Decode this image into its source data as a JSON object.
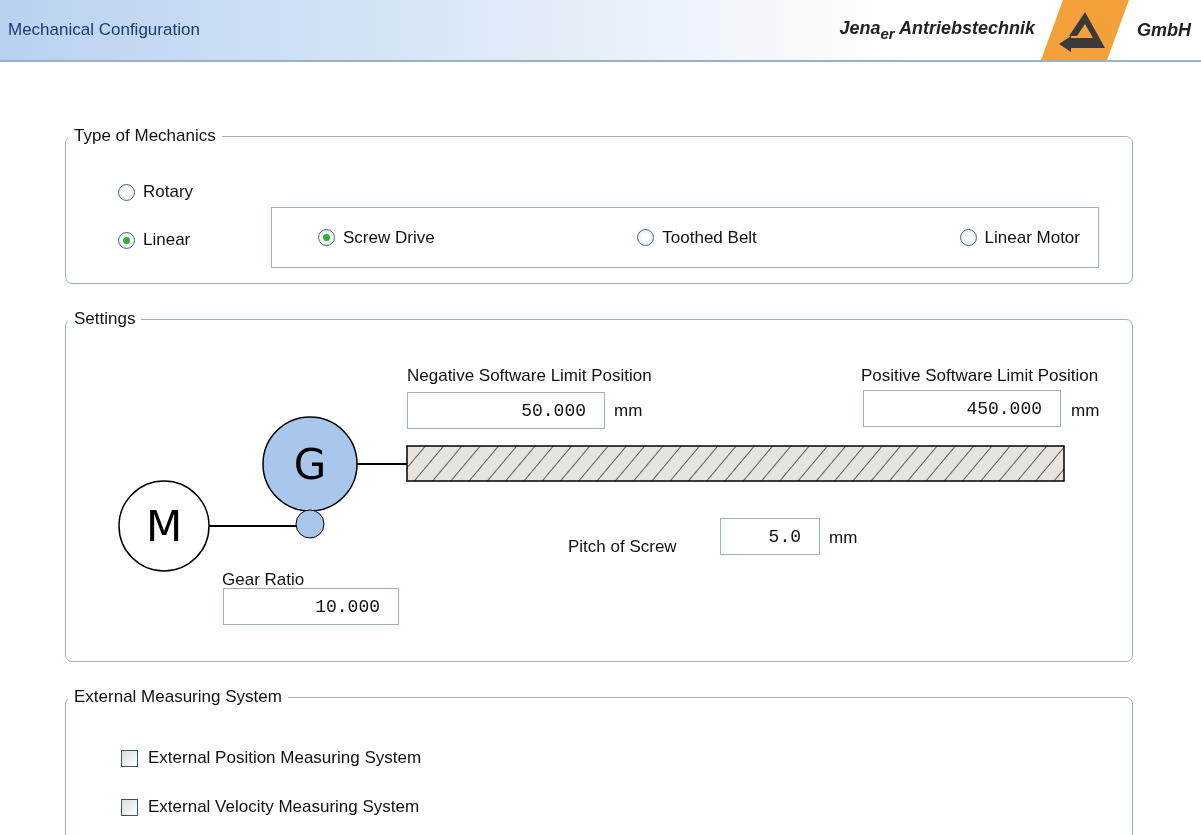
{
  "header": {
    "title": "Mechanical Configuration",
    "logo": {
      "text_left": "Jena$_{er}$ Antriebstechnik",
      "text_right": "GmbH"
    }
  },
  "type_of_mechanics": {
    "legend": "Type of Mechanics",
    "types": [
      {
        "label": "Rotary",
        "selected": false
      },
      {
        "label": "Linear",
        "selected": true
      }
    ],
    "linear_options": [
      {
        "label": "Screw Drive",
        "selected": true
      },
      {
        "label": "Toothed Belt",
        "selected": false
      },
      {
        "label": "Linear Motor",
        "selected": false
      }
    ]
  },
  "settings": {
    "legend": "Settings",
    "motor_label": "M",
    "gear_label": "G",
    "negative_limit": {
      "label": "Negative Software Limit Position",
      "value": "50.000",
      "unit": "mm"
    },
    "positive_limit": {
      "label": "Positive Software Limit Position",
      "value": "450.000",
      "unit": "mm"
    },
    "pitch": {
      "label": "Pitch of Screw",
      "value": "5.0",
      "unit": "mm"
    },
    "gear_ratio": {
      "label": "Gear Ratio",
      "value": "10.000"
    }
  },
  "external_measuring": {
    "legend": "External Measuring System",
    "options": [
      {
        "label": "External Position Measuring System",
        "checked": false
      },
      {
        "label": "External Velocity Measuring System",
        "checked": false
      }
    ]
  }
}
